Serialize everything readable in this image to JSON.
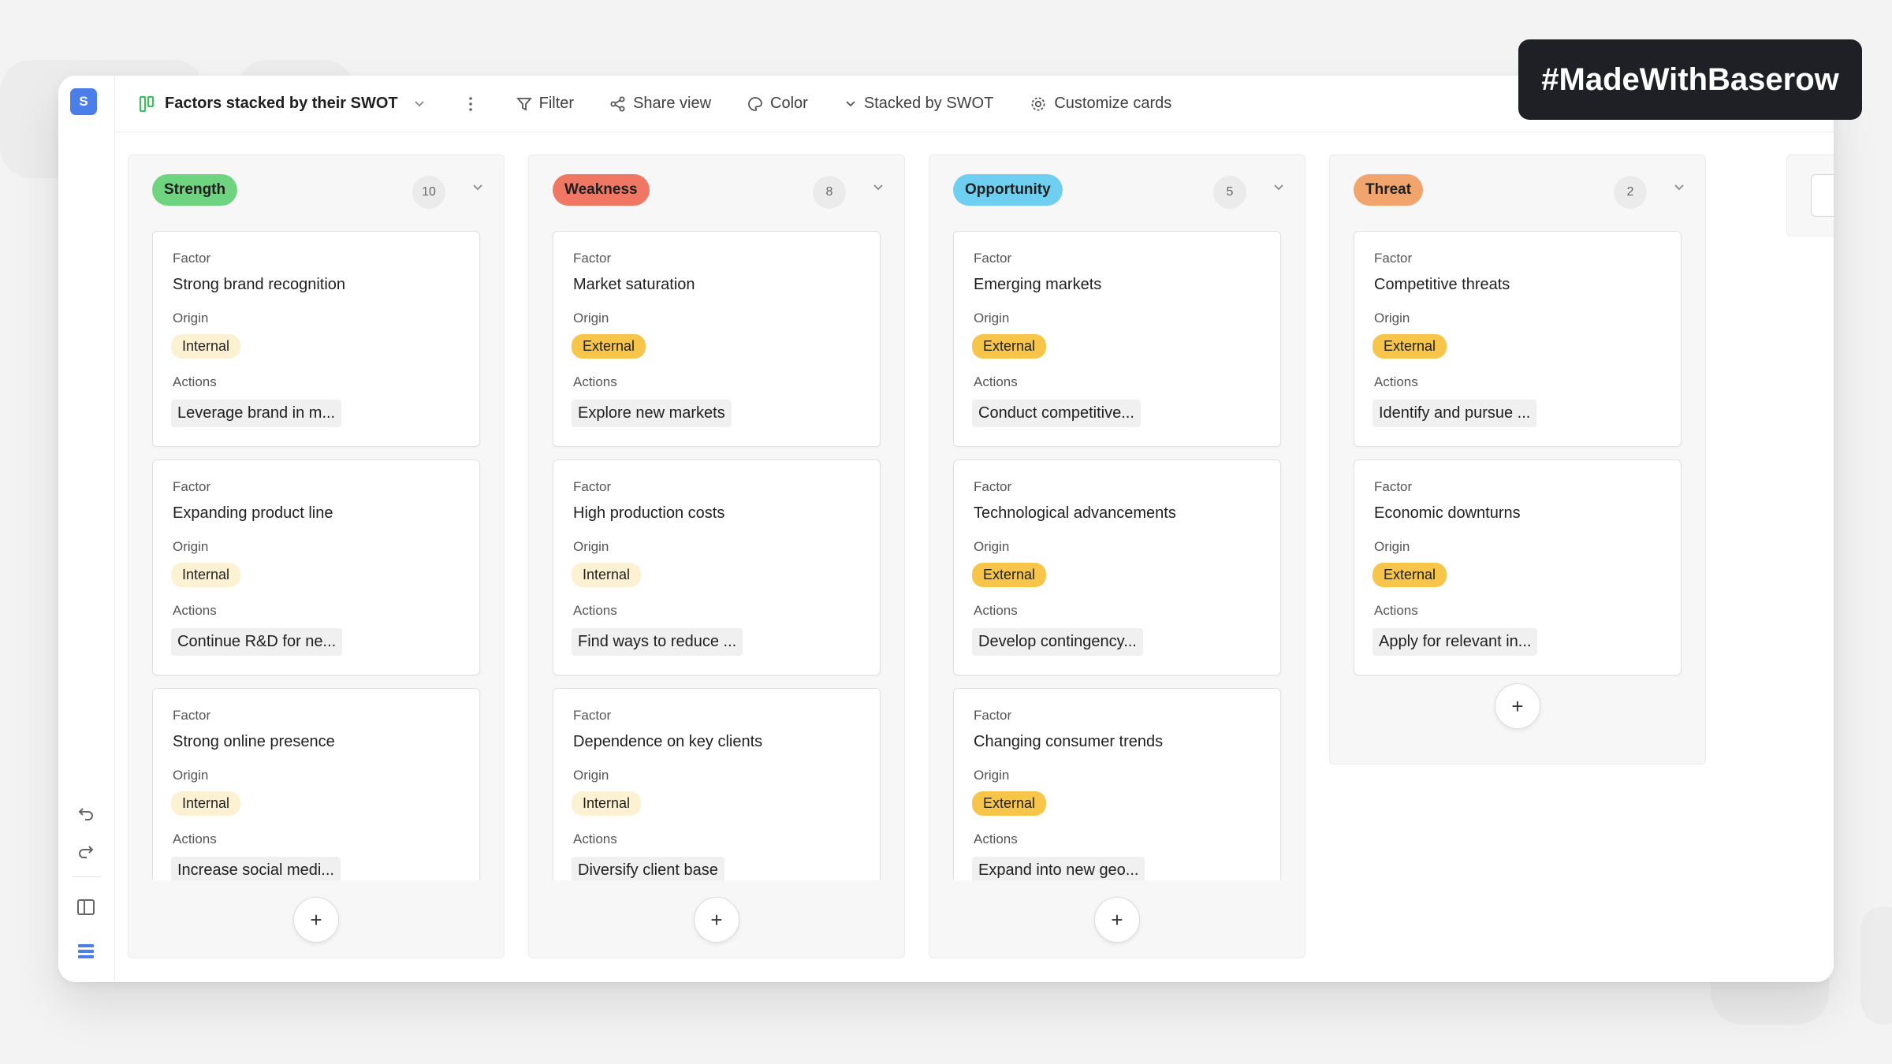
{
  "app": {
    "logo_letter": "S"
  },
  "toolbar": {
    "view_name": "Factors stacked by their SWOT",
    "filter": "Filter",
    "share": "Share view",
    "color": "Color",
    "stacked": "Stacked by SWOT",
    "customize": "Customize cards"
  },
  "brand": "#MadeWithBaserow",
  "labels": {
    "factor": "Factor",
    "origin": "Origin",
    "actions": "Actions",
    "add": "+"
  },
  "columns": [
    {
      "name": "Strength",
      "count": "10",
      "color": "#6fd47f",
      "cards": [
        {
          "factor": "Strong brand recognition",
          "origin": "Internal",
          "action": "Leverage brand in m..."
        },
        {
          "factor": "Expanding product line",
          "origin": "Internal",
          "action": "Continue R&D for ne..."
        },
        {
          "factor": "Strong online presence",
          "origin": "Internal",
          "action": "Increase social medi..."
        }
      ]
    },
    {
      "name": "Weakness",
      "count": "8",
      "color": "#f07763",
      "cards": [
        {
          "factor": "Market saturation",
          "origin": "External",
          "action": "Explore new markets"
        },
        {
          "factor": "High production costs",
          "origin": "Internal",
          "action": "Find ways to reduce ..."
        },
        {
          "factor": "Dependence on key clients",
          "origin": "Internal",
          "action": "Diversify client base"
        }
      ]
    },
    {
      "name": "Opportunity",
      "count": "5",
      "color": "#6ecff0",
      "cards": [
        {
          "factor": "Emerging markets",
          "origin": "External",
          "action": "Conduct competitive..."
        },
        {
          "factor": "Technological advancements",
          "origin": "External",
          "action": "Develop contingency..."
        },
        {
          "factor": "Changing consumer trends",
          "origin": "External",
          "action": "Expand into new geo..."
        }
      ]
    },
    {
      "name": "Threat",
      "count": "2",
      "color": "#f1a56d",
      "cards": [
        {
          "factor": "Competitive threats",
          "origin": "External",
          "action": "Identify and pursue ..."
        },
        {
          "factor": "Economic downturns",
          "origin": "External",
          "action": "Apply for relevant in..."
        }
      ]
    }
  ]
}
